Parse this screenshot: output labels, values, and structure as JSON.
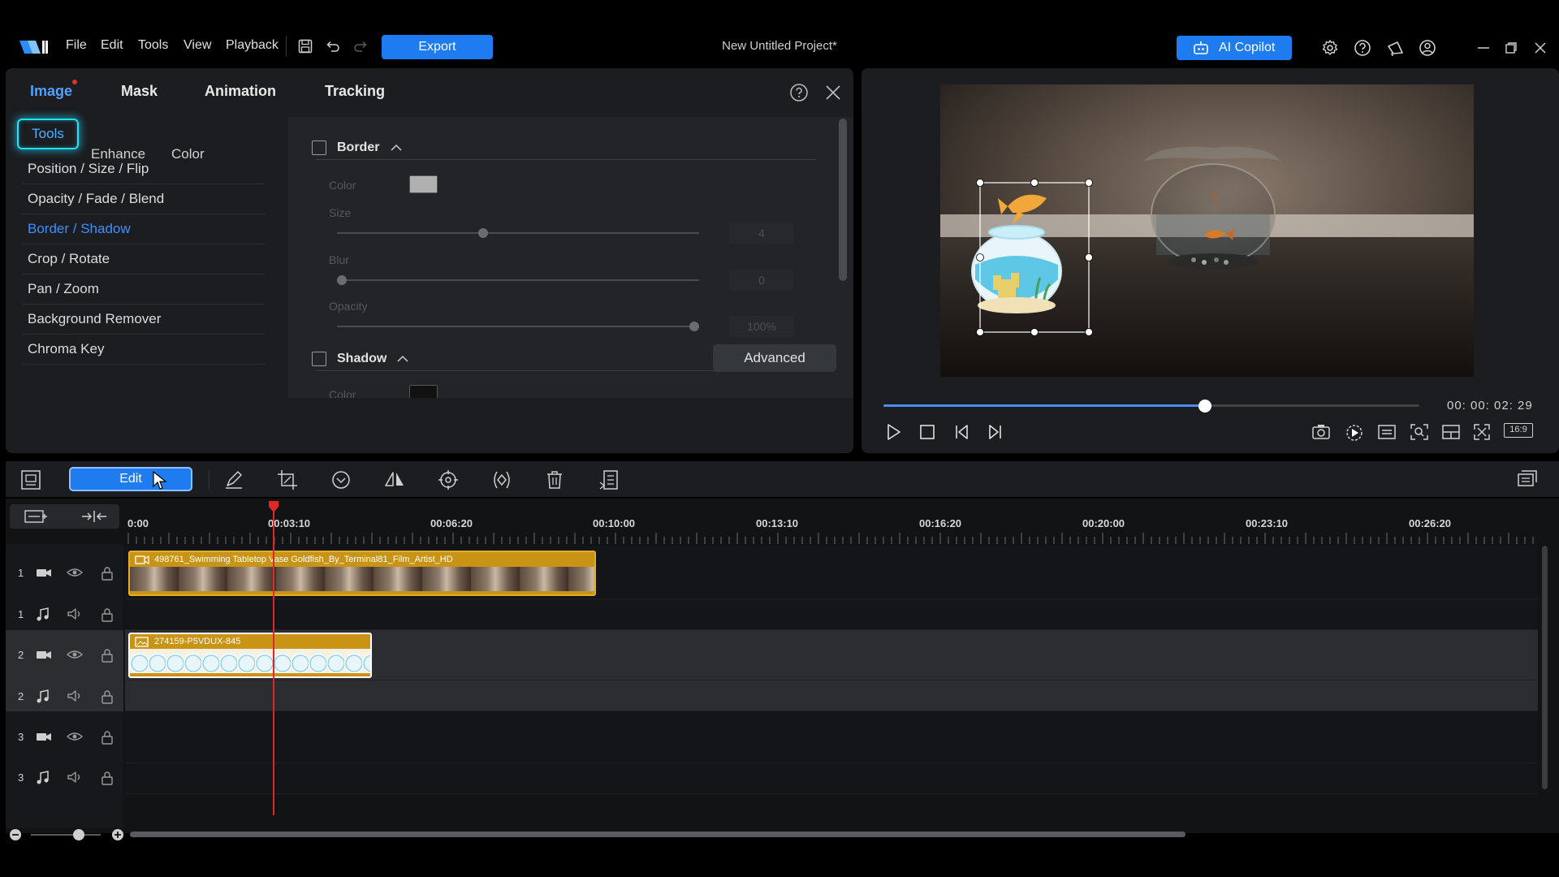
{
  "menubar": {
    "items": [
      "File",
      "Edit",
      "Tools",
      "View",
      "Playback"
    ],
    "export_label": "Export",
    "project_title": "New Untitled Project*",
    "copilot_label": "AI Copilot"
  },
  "properties": {
    "main_tabs": [
      "Image",
      "Mask",
      "Animation",
      "Tracking"
    ],
    "active_main_tab": "Image",
    "sub_tabs": [
      "Tools",
      "Enhance",
      "Color"
    ],
    "active_sub_tab": "Tools",
    "sidebar_items": [
      "Position / Size / Flip",
      "Opacity / Fade / Blend",
      "Border / Shadow",
      "Crop / Rotate",
      "Pan / Zoom",
      "Background Remover",
      "Chroma Key"
    ],
    "active_sidebar_item": "Border / Shadow",
    "border": {
      "title": "Border",
      "checked": false,
      "color_label": "Color",
      "color_value": "#b0b0b0",
      "size_label": "Size",
      "size_value": "4",
      "size_level": 0.4,
      "blur_label": "Blur",
      "blur_value": "0",
      "blur_level": 0,
      "opacity_label": "Opacity",
      "opacity_value": "100%",
      "opacity_level": 1.0
    },
    "shadow": {
      "title": "Shadow",
      "checked": false,
      "color_label": "Color",
      "color_value": "#111111"
    },
    "advanced_label": "Advanced"
  },
  "preview": {
    "timecode": "00: 00: 02: 29",
    "progress": 0.6,
    "aspect_label": "16:9"
  },
  "timeline": {
    "edit_label": "Edit",
    "ruler_labels": [
      "0:00",
      "00:03:10",
      "00:06:20",
      "00:10:00",
      "00:13:10",
      "00:16:20",
      "00:20:00",
      "00:23:10",
      "00:26:20"
    ],
    "tracks": [
      {
        "num": "1",
        "type": "video"
      },
      {
        "num": "1",
        "type": "audio"
      },
      {
        "num": "2",
        "type": "video"
      },
      {
        "num": "2",
        "type": "audio"
      },
      {
        "num": "3",
        "type": "video"
      },
      {
        "num": "3",
        "type": "audio"
      }
    ],
    "clips": [
      {
        "track": "1",
        "title": "498761_Swimming Tabletop Vase Goldfish_By_Terminal81_Film_Artist_HD"
      },
      {
        "track": "2",
        "title": "274159-P5VDUX-845"
      }
    ]
  },
  "colors": {
    "accent": "#1f7cf0",
    "highlight": "#22e0ff",
    "active_text": "#3d8fff",
    "clip": "#b8860b",
    "playhead": "#e02828"
  }
}
